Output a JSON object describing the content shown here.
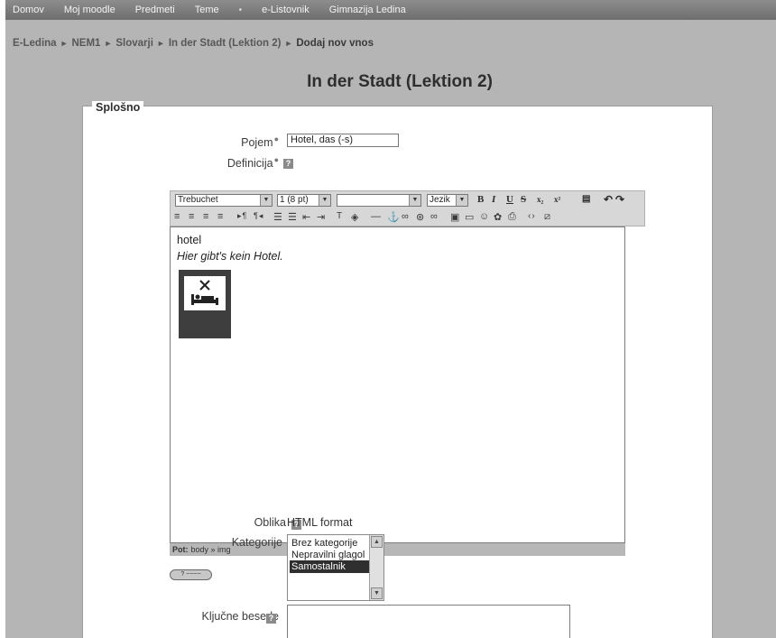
{
  "nav": [
    "Domov",
    "Moj moodle",
    "Predmeti",
    "Teme",
    "e-Listovnik",
    "Gimnazija Ledina"
  ],
  "breadcrumb": {
    "items": [
      "E-Ledina",
      "NEM1",
      "Slovarji",
      "In der Stadt (Lektion 2)"
    ],
    "current": "Dodaj nov vnos",
    "separator": "►"
  },
  "page_title": "In der Stadt (Lektion 2)",
  "form": {
    "legend": "Splošno",
    "pojem_label": "Pojem",
    "pojem_value": "Hotel, das (-s)",
    "definicija_label": "Definicija",
    "oblika_label": "Oblika",
    "oblika_value": "HTML format",
    "kategorije_label": "Kategorije",
    "kategorije_options": [
      "Brez kategorije",
      "Nepravilni glagol",
      "Samostalnik"
    ],
    "kategorije_selected": "Samostalnik",
    "kljucne_label": "Ključne besede"
  },
  "editor": {
    "font": "Trebuchet",
    "size": "1 (8 pt)",
    "style": "",
    "language": "Jezik",
    "content_line1": "hotel",
    "content_line2": "Hier gibt's kein Hotel.",
    "path_label": "Pot:",
    "path_value": "body » img",
    "wiki_label": "? ~~~~"
  },
  "colors": {
    "background": "#b5b5b5",
    "nav_bar": "#7a7a7a",
    "panel": "#ffffff",
    "selected_option": "#2f2f2f"
  }
}
